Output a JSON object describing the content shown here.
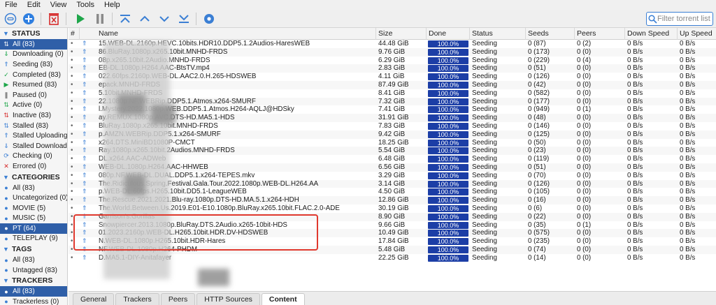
{
  "menu": [
    "File",
    "Edit",
    "View",
    "Tools",
    "Help"
  ],
  "toolbar": {
    "filter_placeholder": "Filter torrent list..."
  },
  "sidebar": {
    "status_header": "STATUS",
    "status_items": [
      {
        "label": "All (83)",
        "icon": "all-icon",
        "selected": true
      },
      {
        "label": "Downloading (0)",
        "icon": "downloading-icon"
      },
      {
        "label": "Seeding (83)",
        "icon": "seeding-icon"
      },
      {
        "label": "Completed (83)",
        "icon": "completed-icon"
      },
      {
        "label": "Resumed (83)",
        "icon": "resumed-icon"
      },
      {
        "label": "Paused (0)",
        "icon": "paused-icon"
      },
      {
        "label": "Active (0)",
        "icon": "active-icon"
      },
      {
        "label": "Inactive (83)",
        "icon": "inactive-icon"
      },
      {
        "label": "Stalled (83)",
        "icon": "stalled-icon"
      },
      {
        "label": "Stalled Uploading",
        "icon": "stalled-uploading-icon"
      },
      {
        "label": "Stalled Download",
        "icon": "stalled-downloading-icon"
      },
      {
        "label": "Checking (0)",
        "icon": "checking-icon"
      },
      {
        "label": "Errored (0)",
        "icon": "errored-icon"
      }
    ],
    "categories_header": "CATEGORIES",
    "category_items": [
      {
        "label": "All (83)"
      },
      {
        "label": "Uncategorized (0)"
      },
      {
        "label": "MOVIE (5)"
      },
      {
        "label": "MUSIC (5)"
      },
      {
        "label": "PT (64)",
        "selected": true
      },
      {
        "label": "TELEPLAY (9)"
      }
    ],
    "tags_header": "TAGS",
    "tag_items": [
      {
        "label": "All (83)"
      },
      {
        "label": "Untagged (83)"
      }
    ],
    "trackers_header": "TRACKERS",
    "tracker_items": [
      {
        "label": "All (83)",
        "selected": true
      },
      {
        "label": "Trackerless (0)"
      }
    ]
  },
  "table": {
    "columns": [
      "#",
      "Name",
      "Size",
      "Done",
      "Status",
      "Seeds",
      "Peers",
      "Down Speed",
      "Up Speed"
    ],
    "rows": [
      {
        "name": "15.WEB-DL.2160p.HEVC.10bits.HDR10.DDP5.1.2Audios-HaresWEB",
        "size": "44.48 GiB",
        "done": "100.0%",
        "status": "Seeding",
        "seeds": "0 (87)",
        "peers": "0 (2)",
        "down": "0 B/s",
        "up": "0 B/s"
      },
      {
        "name": "86.BluRay.1080p.x265.10bit.MNHD-FRDS",
        "size": "9.76 GiB",
        "done": "100.0%",
        "status": "Seeding",
        "seeds": "0 (173)",
        "peers": "0 (0)",
        "down": "0 B/s",
        "up": "0 B/s"
      },
      {
        "name": "08p.x265.10bit.2Audio.MNHD-FRDS",
        "size": "6.29 GiB",
        "done": "100.0%",
        "status": "Seeding",
        "seeds": "0 (229)",
        "peers": "0 (4)",
        "down": "0 B/s",
        "up": "0 B/s"
      },
      {
        "name": "EB-DL.1080p.H264.AAC-BtsTV.mp4",
        "size": "2.83 GiB",
        "done": "100.0%",
        "status": "Seeding",
        "seeds": "0 (51)",
        "peers": "0 (0)",
        "down": "0 B/s",
        "up": "0 B/s"
      },
      {
        "name": "022.60fps.2160p.WEB-DL.AAC2.0.H.265-HDSWEB",
        "size": "4.11 GiB",
        "done": "100.0%",
        "status": "Seeding",
        "seeds": "0 (126)",
        "peers": "0 (0)",
        "down": "0 B/s",
        "up": "0 B/s"
      },
      {
        "name": "epack.MNHD-FRDS",
        "size": "87.49 GiB",
        "done": "100.0%",
        "status": "Seeding",
        "seeds": "0 (42)",
        "peers": "0 (0)",
        "down": "0 B/s",
        "up": "0 B/s"
      },
      {
        "name": "5.10bit.MNHD-FRDS",
        "size": "8.41 GiB",
        "done": "100.0%",
        "status": "Seeding",
        "seeds": "0 (582)",
        "peers": "0 (0)",
        "down": "0 B/s",
        "up": "0 B/s"
      },
      {
        "name": "22.1080p.NF.WEBRip.DDP5.1.Atmos.x264-SMURF",
        "size": "7.32 GiB",
        "done": "100.0%",
        "status": "Seeding",
        "seeds": "0 (177)",
        "peers": "0 (0)",
        "down": "0 B/s",
        "up": "0 B/s"
      },
      {
        "name": "l.Mystery.2022.1080p.WEB.DDP5.1.Atmos.H264-AQLJ@HDSky",
        "size": "7.41 GiB",
        "done": "100.0%",
        "status": "Seeding",
        "seeds": "0 (949)",
        "peers": "0 (1)",
        "down": "0 B/s",
        "up": "0 B/s"
      },
      {
        "name": "ay.REMUX.1080p.AVC.DTS-HD.MA5.1-HDS",
        "size": "31.91 GiB",
        "done": "100.0%",
        "status": "Seeding",
        "seeds": "0 (48)",
        "peers": "0 (0)",
        "down": "0 B/s",
        "up": "0 B/s"
      },
      {
        "name": "BluRay.1080p.x265.10bit.MNHD-FRDS",
        "size": "7.83 GiB",
        "done": "100.0%",
        "status": "Seeding",
        "seeds": "0 (146)",
        "peers": "0 (0)",
        "down": "0 B/s",
        "up": "0 B/s"
      },
      {
        "name": "p.AMZN.WEBRip.DDP5.1.x264-SMURF",
        "size": "9.42 GiB",
        "done": "100.0%",
        "status": "Seeding",
        "seeds": "0 (125)",
        "peers": "0 (0)",
        "down": "0 B/s",
        "up": "0 B/s"
      },
      {
        "name": "x264.DTS.MiniBD1080P-CMCT",
        "size": "18.25 GiB",
        "done": "100.0%",
        "status": "Seeding",
        "seeds": "0 (50)",
        "peers": "0 (0)",
        "down": "0 B/s",
        "up": "0 B/s"
      },
      {
        "name": "Ray.1080p.x265.10bit.2Audios.MNHD-FRDS",
        "size": "5.54 GiB",
        "done": "100.0%",
        "status": "Seeding",
        "seeds": "0 (23)",
        "peers": "0 (0)",
        "down": "0 B/s",
        "up": "0 B/s"
      },
      {
        "name": "DL.x264.AAC-ADWeb",
        "size": "6.48 GiB",
        "done": "100.0%",
        "status": "Seeding",
        "seeds": "0 (119)",
        "peers": "0 (0)",
        "down": "0 B/s",
        "up": "0 B/s"
      },
      {
        "name": "WEB-DL.1080p.H264.AAC-HHWEB",
        "size": "6.56 GiB",
        "done": "100.0%",
        "status": "Seeding",
        "seeds": "0 (51)",
        "peers": "0 (0)",
        "down": "0 B/s",
        "up": "0 B/s"
      },
      {
        "name": "080p.NF.WEB-DL.DUAL.DDP5.1.x264-TEPES.mkv",
        "size": "3.29 GiB",
        "done": "100.0%",
        "status": "Seeding",
        "seeds": "0 (70)",
        "peers": "0 (0)",
        "down": "0 B/s",
        "up": "0 B/s"
      },
      {
        "name": "The.Ridiculous.Spring.Festival.Gala.Tour.2022.1080p.WEB-DL.H264.AA",
        "size": "3.14 GiB",
        "done": "100.0%",
        "status": "Seeding",
        "seeds": "0 (126)",
        "peers": "0 (0)",
        "down": "0 B/s",
        "up": "0 B/s"
      },
      {
        "name": "p.WEB-DL.60fps.H265.10bit.DD5.1-LeagueWEB",
        "size": "4.50 GiB",
        "done": "100.0%",
        "status": "Seeding",
        "seeds": "0 (105)",
        "peers": "0 (0)",
        "down": "0 B/s",
        "up": "0 B/s"
      },
      {
        "name": "The.Rescue.2021.2021.Blu-ray.1080p.DTS-HD.MA.5.1.x264-HDH",
        "size": "12.86 GiB",
        "done": "100.0%",
        "status": "Seeding",
        "seeds": "0 (16)",
        "peers": "0 (0)",
        "down": "0 B/s",
        "up": "0 B/s"
      },
      {
        "name": "The.World.Between.Us.2019.E01-E10.1080p.BluRay.x265.10bit.FLAC.2.0-ADE",
        "size": "30.19 GiB",
        "done": "100.0%",
        "status": "Seeding",
        "seeds": "0 (6)",
        "peers": "0 (0)",
        "down": "0 B/s",
        "up": "0 B/s"
      },
      {
        "name": "Garrison's.Gorillas",
        "size": "8.90 GiB",
        "done": "100.0%",
        "status": "Seeding",
        "seeds": "0 (22)",
        "peers": "0 (0)",
        "down": "0 B/s",
        "up": "0 B/s"
      },
      {
        "name": "Snowpiercer.2013.1080p.BluRay.DTS.2Audio.x265-10bit-HDS",
        "size": "9.66 GiB",
        "done": "100.0%",
        "status": "Seeding",
        "seeds": "0 (35)",
        "peers": "0 (1)",
        "down": "0 B/s",
        "up": "0 B/s"
      },
      {
        "name": "01.2023.2160p.WEB-DL.H265.10bit.HDR.DV-HDSWEB",
        "size": "10.49 GiB",
        "done": "100.0%",
        "status": "Seeding",
        "seeds": "0 (575)",
        "peers": "0 (0)",
        "down": "0 B/s",
        "up": "0 B/s"
      },
      {
        "name": "N.WEB-DL.1080p.H265.10bit.HDR-Hares",
        "size": "17.84 GiB",
        "done": "100.0%",
        "status": "Seeding",
        "seeds": "0 (235)",
        "peers": "0 (0)",
        "down": "0 B/s",
        "up": "0 B/s"
      },
      {
        "name": "NF.WEB-DL.1080p.H264-PHDM",
        "size": "5.48 GiB",
        "done": "100.0%",
        "status": "Seeding",
        "seeds": "0 (74)",
        "peers": "0 (0)",
        "down": "0 B/s",
        "up": "0 B/s"
      },
      {
        "name": "D.MA5.1-DIY-Anitafayer",
        "size": "22.25 GiB",
        "done": "100.0%",
        "status": "Seeding",
        "seeds": "0 (14)",
        "peers": "0 (0)",
        "down": "0 B/s",
        "up": "0 B/s"
      }
    ]
  },
  "bottom_tabs": [
    "General",
    "Trackers",
    "Peers",
    "HTTP Sources",
    "Content"
  ],
  "colors": {
    "accent": "#3b7fd4",
    "progress": "#1c3ea6",
    "selected": "#2f5fa8",
    "highlight": "#e0392e"
  }
}
